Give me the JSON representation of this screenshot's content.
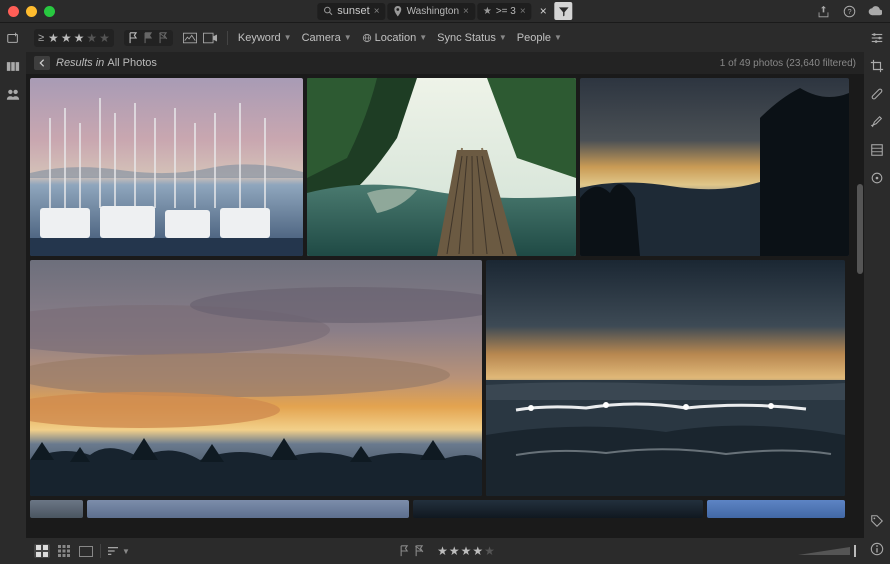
{
  "search": {
    "chips": [
      {
        "icon": "search",
        "label": "sunset"
      },
      {
        "icon": "pin",
        "label": "Washington"
      },
      {
        "icon": "star",
        "label": ">= 3"
      }
    ]
  },
  "toolbar": {
    "rating_gte": "≥",
    "rating_value": 3,
    "dropdowns": {
      "keyword": "Keyword",
      "camera": "Camera",
      "location": "Location",
      "sync": "Sync Status",
      "people": "People"
    }
  },
  "breadcrumb": {
    "prefix": "Results in ",
    "target": "All Photos",
    "count_text": "1 of 49 photos   (23,640 filtered)"
  },
  "bottom": {
    "rating_value": 4
  },
  "colors": {
    "panel": "#2b2b2b",
    "panel_dark": "#1a1a1a",
    "text": "#c9c9c9"
  }
}
